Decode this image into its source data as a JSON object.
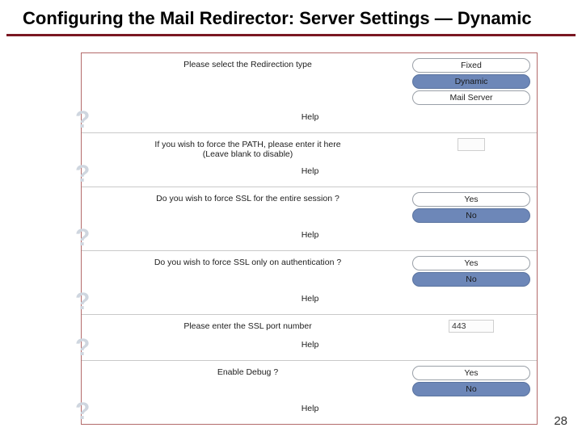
{
  "slide": {
    "title": "Configuring the Mail Redirector: Server Settings — Dynamic",
    "page_number": "28"
  },
  "help_label": "Help",
  "sections": {
    "redirection": {
      "question": "Please select the Redirection type",
      "options": [
        "Fixed",
        "Dynamic",
        "Mail Server"
      ],
      "selected": "Dynamic"
    },
    "path": {
      "question": "If you wish to force the PATH, please enter it here",
      "hint": "(Leave blank to disable)",
      "value": ""
    },
    "ssl_session": {
      "question": "Do you wish to force SSL for the entire session ?",
      "options": [
        "Yes",
        "No"
      ],
      "selected": "No"
    },
    "ssl_auth": {
      "question": "Do you wish to force SSL only on authentication ?",
      "options": [
        "Yes",
        "No"
      ],
      "selected": "No"
    },
    "ssl_port": {
      "question": "Please enter the SSL port number",
      "value": "443"
    },
    "debug": {
      "question": "Enable Debug ?",
      "options": [
        "Yes",
        "No"
      ],
      "selected": "No"
    }
  }
}
